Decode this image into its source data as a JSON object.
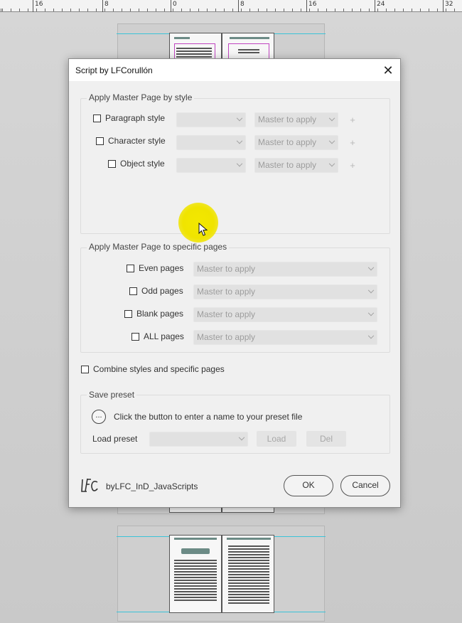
{
  "ruler": {
    "ticks": [
      "16",
      "8",
      "0",
      "8",
      "16",
      "24",
      "32"
    ]
  },
  "dialog": {
    "title": "Script by LFCorullón",
    "close_glyph": "✕",
    "by_style": {
      "title": "Apply Master Page by style",
      "rows": [
        {
          "label": "Paragraph style",
          "style_placeholder": "",
          "master_placeholder": "Master to apply",
          "plus": "+"
        },
        {
          "label": "Character style",
          "style_placeholder": "",
          "master_placeholder": "Master to apply",
          "plus": "+"
        },
        {
          "label": "Object style",
          "style_placeholder": "",
          "master_placeholder": "Master to apply",
          "plus": "+"
        }
      ]
    },
    "specific_pages": {
      "title": "Apply Master Page to specific pages",
      "rows": [
        {
          "label": "Even pages",
          "master_placeholder": "Master to apply"
        },
        {
          "label": "Odd pages",
          "master_placeholder": "Master to apply"
        },
        {
          "label": "Blank pages",
          "master_placeholder": "Master to apply"
        },
        {
          "label": "ALL pages",
          "master_placeholder": "Master to apply"
        }
      ]
    },
    "combine_label": "Combine styles and specific pages",
    "save_preset": {
      "title": "Save preset",
      "ellipsis": "...",
      "hint": "Click the button to enter a name to your preset file",
      "load_label": "Load preset",
      "load_button": "Load",
      "del_button": "Del"
    },
    "footer": {
      "brand": "byLFC_InD_JavaScripts",
      "ok": "OK",
      "cancel": "Cancel"
    }
  },
  "colors": {
    "guide": "#3bc3d8",
    "halo": "#f0e400",
    "frame": "#c045c0"
  }
}
